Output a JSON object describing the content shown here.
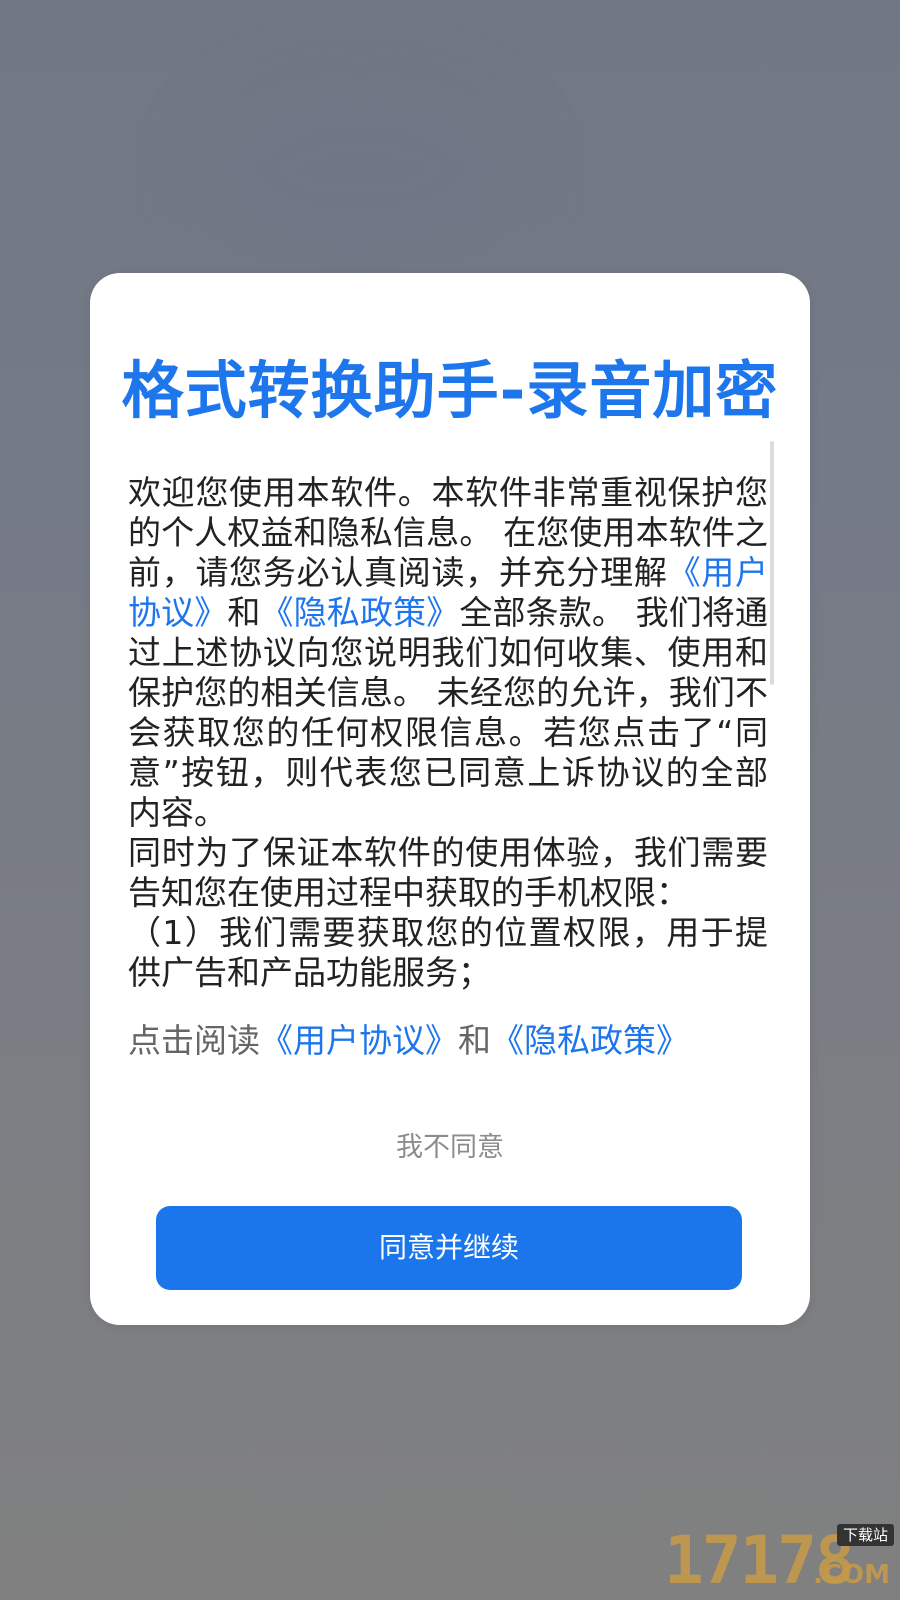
{
  "dialog": {
    "title": "格式转换助手-录音加密",
    "body": {
      "p1_a": "欢迎您使用本软件。本软件非常重视保护您的个人权益和隐私信息。 在您使用本软件之前，请您务必认真阅读，并充分理解",
      "p1_link1": "《用户协议》",
      "p1_and": "和",
      "p1_link2": "《隐私政策》",
      "p1_b": "全部条款。 我们将通过上述协议向您说明我们如何收集、使用和保护您的相关信息。 未经您的允许，我们不会获取您的任何权限信息。若您点击了“同意”按钮，则代表您已同意上诉协议的全部内容。",
      "p2": " 同时为了保证本软件的使用体验，我们需要告知您在使用过程中获取的手机权限：",
      "p3": "（1）我们需要获取您的位置权限，用于提供广告和产品功能服务；"
    },
    "read_links": {
      "prefix": "点击阅读",
      "user_agreement": "《用户协议》",
      "and": "和",
      "privacy_policy": "《隐私政策》"
    },
    "disagree_label": "我不同意",
    "agree_label": "同意并继续"
  },
  "watermark": {
    "number": "17178",
    "domain": ".COM",
    "badge": "下载站"
  },
  "colors": {
    "accent": "#1e76ec",
    "button": "#1c76eb",
    "overlay": "#747a86"
  }
}
